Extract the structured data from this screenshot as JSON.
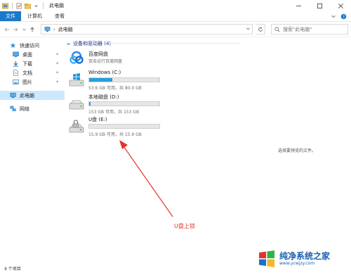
{
  "window": {
    "title": "此电脑"
  },
  "ribbon": {
    "tabs": [
      "文件",
      "计算机",
      "查看"
    ]
  },
  "address": {
    "path": "此电脑"
  },
  "search": {
    "placeholder": "搜索\"此电脑\""
  },
  "sidebar": {
    "items": [
      {
        "label": "快速访问",
        "icon": "star-icon"
      },
      {
        "label": "桌面",
        "icon": "desktop-icon",
        "pinned": true
      },
      {
        "label": "下载",
        "icon": "download-icon",
        "pinned": true
      },
      {
        "label": "文档",
        "icon": "document-icon",
        "pinned": true
      },
      {
        "label": "图片",
        "icon": "picture-icon",
        "pinned": true
      },
      {
        "label": "此电脑",
        "icon": "computer-icon",
        "selected": true
      },
      {
        "label": "网络",
        "icon": "network-icon"
      }
    ]
  },
  "content": {
    "section_title": "设备和驱动器 (4)",
    "cloud": {
      "name": "百度网盘",
      "desc": "双击运行百度网盘"
    },
    "drives": [
      {
        "name": "Windows (C:)",
        "info": "53.6 GB 可用，共 80.0 GB",
        "used_fraction": 0.33,
        "icon": "windows-drive-icon"
      },
      {
        "name": "本地磁盘 (D:)",
        "info": "153 GB 可用，共 153 GB",
        "used_fraction": 0.02,
        "icon": "hard-drive-icon"
      },
      {
        "name": "U盘 (E:)",
        "info": "15.9 GB 可用，共 15.9 GB",
        "used_fraction": 0.0,
        "icon": "locked-drive-icon"
      }
    ]
  },
  "preview": {
    "text": "选择要预览的文件。"
  },
  "annotation": {
    "text": "U盘上锁",
    "color": "#e5322d"
  },
  "status": {
    "text": "4 个项目"
  },
  "watermark": {
    "title": "纯净系统之家",
    "url": "www.ycwjzy.com"
  },
  "colors": {
    "accent": "#1979ca",
    "bar": "#26a0da",
    "selected_bg": "#cce8ff"
  }
}
